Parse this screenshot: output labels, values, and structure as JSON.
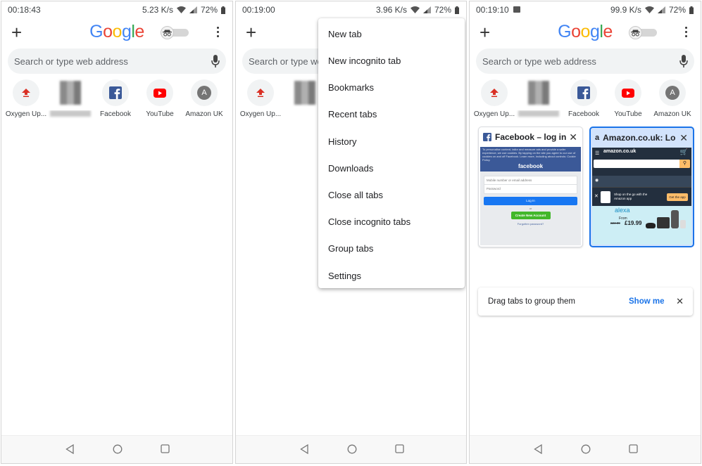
{
  "panes": [
    {
      "status": {
        "time": "00:18:43",
        "speed": "5.23 K/s",
        "battery": "72%"
      },
      "logo": "Google",
      "search_placeholder": "Search or type web address",
      "shortcuts": [
        "Oxygen Up...",
        "",
        "Facebook",
        "YouTube",
        "Amazon UK"
      ]
    },
    {
      "status": {
        "time": "00:19:00",
        "speed": "3.96 K/s",
        "battery": "72%"
      },
      "search_placeholder": "Search or type we",
      "shortcuts": [
        "Oxygen Up...",
        ""
      ],
      "menu": [
        "New tab",
        "New incognito tab",
        "Bookmarks",
        "Recent tabs",
        "History",
        "Downloads",
        "Close all tabs",
        "Close incognito tabs",
        "Group tabs",
        "Settings"
      ]
    },
    {
      "status": {
        "time": "00:19:10",
        "speed": "99.9 K/s",
        "battery": "72%"
      },
      "logo": "Google",
      "search_placeholder": "Search or type web address",
      "shortcuts": [
        "Oxygen Up...",
        "",
        "Facebook",
        "YouTube",
        "Amazon UK"
      ],
      "tabs": [
        {
          "title": "Facebook – log in",
          "favicon": "facebook-icon"
        },
        {
          "title": "Amazon.co.uk: Lo",
          "favicon": "amazon-icon"
        }
      ],
      "facebook_thumb": {
        "notice": "To personalise content, tailor and measure ads and provide a safer experience, we use cookies. By tapping on the site you agree to our use of cookies on and off Facebook. Learn more, including about controls: Cookie Policy.",
        "brand": "facebook",
        "field1": "Mobile number or email address",
        "field2": "Password",
        "login": "Log In",
        "or": "or",
        "create": "Create New Account",
        "forgot": "Forgotten password?"
      },
      "amazon_thumb": {
        "brand": "amazon.co.uk",
        "promo": "Shop on the go with the Amazon app",
        "get_app": "Get the app",
        "alexa": "alexa",
        "from": "From",
        "old_price": "£24.99",
        "new_price": "£19.99"
      },
      "banner": {
        "text": "Drag tabs to group them",
        "action": "Show me"
      }
    }
  ],
  "colors": {
    "google_blue": "#4285F4",
    "google_red": "#EA4335",
    "google_yellow": "#FBBC05",
    "google_green": "#34A853",
    "facebook_blue": "#3b5998",
    "youtube_red": "#ff0000",
    "oxygen_red": "#d93025",
    "link_blue": "#1a73e8",
    "selected_tab": "#1a73e8",
    "amazon_dark": "#232f3e",
    "alexa_bg": "#cdeef5"
  }
}
